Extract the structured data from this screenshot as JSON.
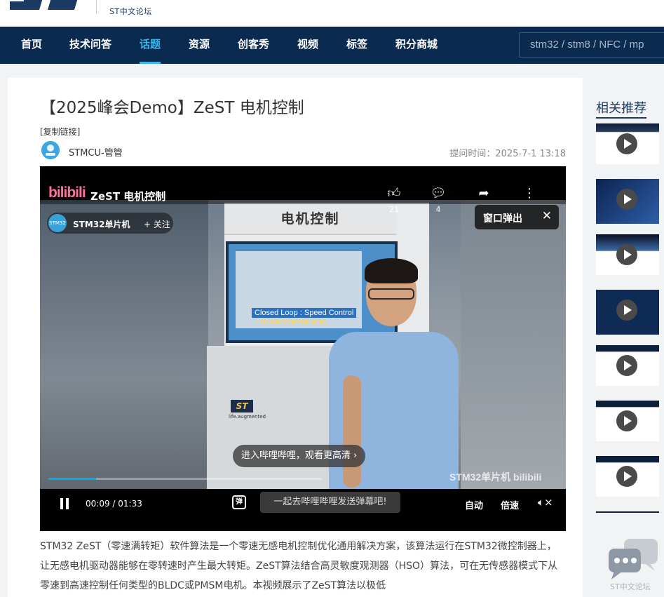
{
  "site": {
    "logo_text": "ST中文论坛"
  },
  "nav": {
    "items": [
      "首页",
      "技术问答",
      "话题",
      "资源",
      "创客秀",
      "视频",
      "标签",
      "积分商城"
    ],
    "active_index": 2,
    "search_placeholder": "stm32 / stm8 / NFC / mp"
  },
  "post": {
    "title": "【2025峰会Demo】ZeST 电机控制",
    "copy_link": "[复制链接]",
    "author": "STMCU-管管",
    "time": "提问时间：2025-7-1 13:18",
    "description": "STM32 ZeST（零速满转矩）软件算法是一个零速无感电机控制优化通用解决方案，该算法运行在STM32微控制器上，让无感电机驱动器能够在零转速时产生最大转矩。ZeST算法结合高灵敏度观测器（HSO）算法，可在无传感器模式下从零速到高速控制任何类型的BLDC或PMSM电机。本视频展示了ZeST算法以极低"
  },
  "video": {
    "brand": "bilibili",
    "title": "ZeST 电机控制",
    "likes": "21",
    "comments": "4",
    "share_label": "分享",
    "more_label": "更多",
    "channel_name": "STM32单片机",
    "channel_avatar_text": "STM32",
    "follow_label": "+ 关注",
    "popout_label": "窗口弹出",
    "scene_sign": "电机控制",
    "screen_caption": "Closed Loop : Speed Control",
    "screen_sub": "4 Hz Electrical Frequency",
    "st_sub": "life.augmented",
    "watermark": "STM32单片机  bilibili",
    "enter_label": "进入哔哩哔哩，观看更高清 ›",
    "time_current": "00:09",
    "time_total": "01:33",
    "progress": 0.097,
    "danmaku_icon": "弹",
    "danmaku_placeholder": "一起去哔哩哔哩发送弹幕吧!",
    "auto_label": "自动",
    "speed_label": "倍速"
  },
  "sidebar": {
    "title": "相关推荐",
    "thumbnails": 7,
    "float_label": "ST中文论坛"
  },
  "colors": {
    "nav_bg": "#0b2a4f",
    "accent": "#3fb5ea",
    "bili_pink": "#fb7299",
    "bili_blue": "#00aeec"
  },
  "icons": [
    "like-icon",
    "comment-icon",
    "share-icon",
    "more-icon",
    "close-icon",
    "pause-icon",
    "danmaku-icon",
    "mute-icon",
    "play-icon",
    "chat-bubble-icon"
  ]
}
